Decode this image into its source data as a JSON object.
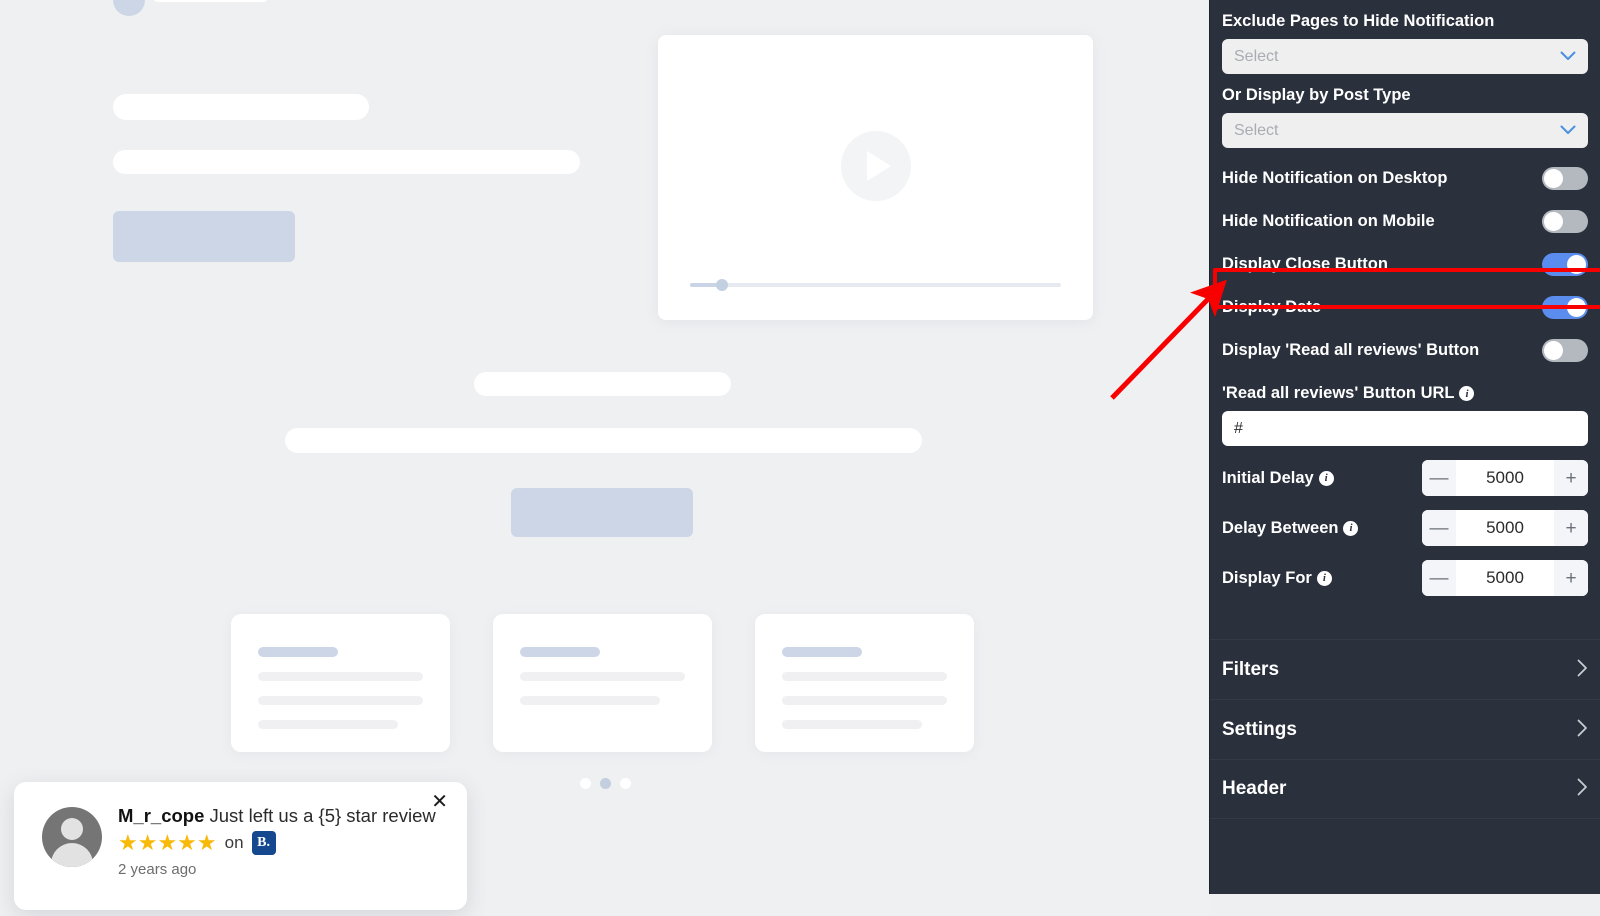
{
  "preview": {
    "video_card": {
      "play_icon": "play-icon"
    },
    "carousel": {
      "dots": 3,
      "active_index": 1
    }
  },
  "review_popup": {
    "reviewer_name": "M_r_cope",
    "message": "Just left us a {5} star review",
    "stars": "★★★★★",
    "star_count": 5,
    "on_label": "on",
    "source_badge": "B.",
    "timestamp": "2 years ago",
    "close_icon": "✕",
    "star_color": "#f8b908",
    "source_color": "#16488f"
  },
  "panel": {
    "exclude_pages": {
      "label": "Exclude Pages to Hide Notification",
      "placeholder": "Select",
      "value": ""
    },
    "post_type": {
      "label": "Or Display by Post Type",
      "placeholder": "Select",
      "value": ""
    },
    "toggles": [
      {
        "label": "Hide Notification on Desktop",
        "state": "off"
      },
      {
        "label": "Hide Notification on Mobile",
        "state": "off"
      },
      {
        "label": "Display Close Button",
        "state": "on"
      },
      {
        "label": "Display Date",
        "state": "on"
      },
      {
        "label": "Display 'Read all reviews' Button",
        "state": "off"
      }
    ],
    "read_all_url": {
      "label": "'Read all reviews' Button URL",
      "info": "i",
      "value": "#"
    },
    "steppers": [
      {
        "label": "Initial Delay",
        "info": "i",
        "value": "5000",
        "minus": "—",
        "plus": "+"
      },
      {
        "label": "Delay Between",
        "info": "i",
        "value": "5000",
        "minus": "—",
        "plus": "+"
      },
      {
        "label": "Display For",
        "info": "i",
        "value": "5000",
        "minus": "—",
        "plus": "+"
      }
    ],
    "accordions": [
      {
        "label": "Filters",
        "chevron": "›"
      },
      {
        "label": "Settings",
        "chevron": "›"
      },
      {
        "label": "Header",
        "chevron": "›"
      }
    ],
    "colors": {
      "panel_bg": "#2a303c",
      "toggle_on": "#5b8def",
      "toggle_off": "#b4b9c0",
      "chevron_blue": "#4a90e2"
    }
  },
  "annotations": {
    "highlight_color": "#f90000",
    "highlight_target": "Display Close Button",
    "arrow_color": "#f90000"
  }
}
